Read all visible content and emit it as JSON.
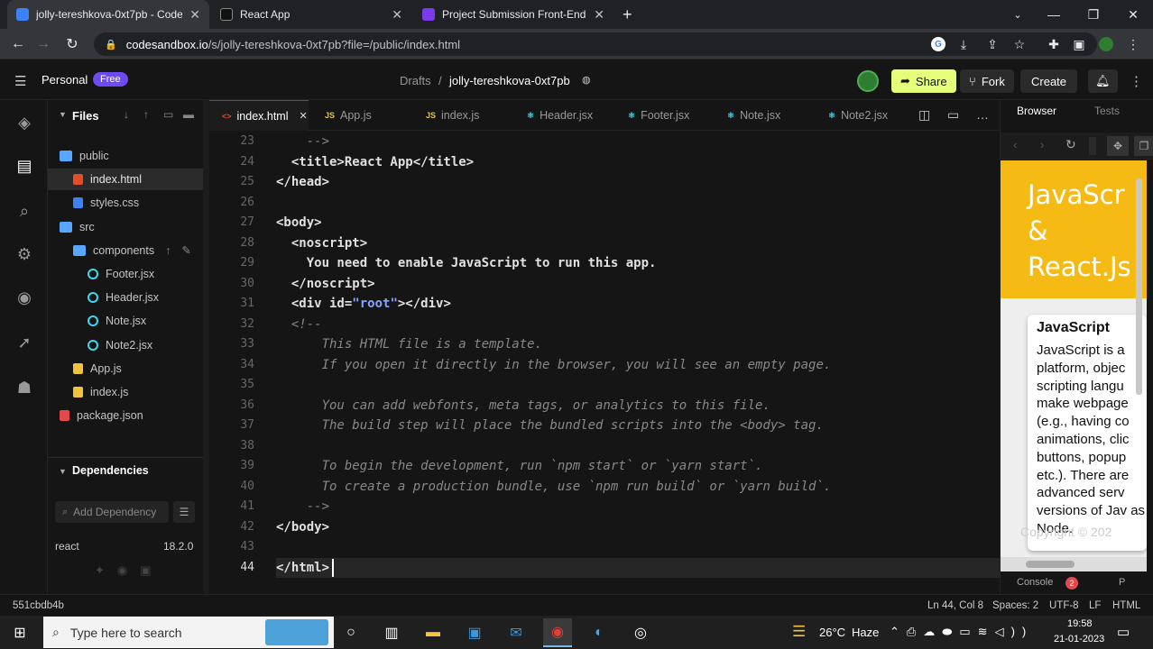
{
  "browser": {
    "tabs": [
      {
        "title": "jolly-tereshkova-0xt7pb - CodeSandbox",
        "color": "#3b82f6"
      },
      {
        "title": "React App",
        "color": "#111111"
      },
      {
        "title": "Project Submission Front-End W...",
        "color": "#7c3aed"
      }
    ],
    "url_host": "codesandbox.io",
    "url_path": "/s/jolly-tereshkova-0xt7pb?file=/public/index.html"
  },
  "header": {
    "workspace": "Personal",
    "plan_badge": "Free",
    "breadcrumb_root": "Drafts",
    "breadcrumb_sep": "/",
    "sandbox_name": "jolly-tereshkova-0xt7pb",
    "share": "Share",
    "fork": "Fork",
    "create": "Create"
  },
  "sidebar": {
    "files_title": "Files",
    "tree": [
      {
        "label": "public",
        "type": "folder",
        "indent": 0
      },
      {
        "label": "index.html",
        "type": "html",
        "indent": 1,
        "selected": true
      },
      {
        "label": "styles.css",
        "type": "css",
        "indent": 1
      },
      {
        "label": "src",
        "type": "folder",
        "indent": 0
      },
      {
        "label": "components",
        "type": "folder",
        "indent": 1
      },
      {
        "label": "Footer.jsx",
        "type": "react",
        "indent": 2
      },
      {
        "label": "Header.jsx",
        "type": "react",
        "indent": 2
      },
      {
        "label": "Note.jsx",
        "type": "react",
        "indent": 2
      },
      {
        "label": "Note2.jsx",
        "type": "react",
        "indent": 2
      },
      {
        "label": "App.js",
        "type": "js",
        "indent": 1
      },
      {
        "label": "index.js",
        "type": "js",
        "indent": 1
      },
      {
        "label": "package.json",
        "type": "json",
        "indent": 0
      }
    ],
    "deps_title": "Dependencies",
    "deps_placeholder": "Add Dependency",
    "deps": [
      {
        "name": "react",
        "version": "18.2.0"
      }
    ]
  },
  "editor": {
    "tabs": [
      "index.html",
      "App.js",
      "index.js",
      "Header.jsx",
      "Footer.jsx",
      "Note.jsx",
      "Note2.jsx"
    ],
    "lines": [
      {
        "n": "23",
        "html": "<span class='cm'>    --></span>"
      },
      {
        "n": "24",
        "html": "  <span class='b'>&lt;title&gt;React App&lt;/title&gt;</span>"
      },
      {
        "n": "25",
        "html": "<span class='b'>&lt;/head&gt;</span>"
      },
      {
        "n": "26",
        "html": ""
      },
      {
        "n": "27",
        "html": "<span class='b'>&lt;body&gt;</span>"
      },
      {
        "n": "28",
        "html": "  <span class='b'>&lt;noscript&gt;</span>"
      },
      {
        "n": "29",
        "html": "    <span class='b'>You need to enable JavaScript to run this app.</span>"
      },
      {
        "n": "30",
        "html": "  <span class='b'>&lt;/noscript&gt;</span>"
      },
      {
        "n": "31",
        "html": "  <span class='b'>&lt;div id=<span class='str'>\"root\"</span>&gt;&lt;/div&gt;</span>"
      },
      {
        "n": "32",
        "html": "<span class='cm'>  &lt;!--</span>"
      },
      {
        "n": "33",
        "html": "<span class='cm'>      This HTML file is a template.</span>"
      },
      {
        "n": "34",
        "html": "<span class='cm'>      If you open it directly in the browser, you will see an empty page.</span>"
      },
      {
        "n": "35",
        "html": ""
      },
      {
        "n": "36",
        "html": "<span class='cm'>      You can add webfonts, meta tags, or analytics to this file.</span>"
      },
      {
        "n": "37",
        "html": "<span class='cm'>      The build step will place the bundled scripts into the &lt;body&gt; tag.</span>"
      },
      {
        "n": "38",
        "html": ""
      },
      {
        "n": "39",
        "html": "<span class='cm'>      To begin the development, run `npm start` or `yarn start`.</span>"
      },
      {
        "n": "40",
        "html": "<span class='cm'>      To create a production bundle, use `npm run build` or `yarn build`.</span>"
      },
      {
        "n": "41",
        "html": "<span class='cm'>    --></span>"
      },
      {
        "n": "42",
        "html": "<span class='b'>&lt;/body&gt;</span>"
      },
      {
        "n": "43",
        "html": ""
      },
      {
        "n": "44",
        "html": "<span class='b'>&lt;/html&gt;</span>"
      }
    ]
  },
  "preview": {
    "tab_browser": "Browser",
    "tab_tests": "Tests",
    "hero_line1": "JavaScr",
    "hero_line2": "&",
    "hero_line3": "React.Js",
    "card_title": "JavaScript",
    "card_body": "JavaScript is a platform, objec scripting langu make webpage (e.g., having co animations, clic buttons, popup etc.). There are advanced serv versions of Jav as Node.",
    "footer": "Copyright © 202",
    "console": "Console",
    "console_count": "2",
    "extra_tab": "P"
  },
  "status": {
    "commit": "551cbdb4b",
    "position": "Ln 44, Col 8",
    "spaces": "Spaces: 2",
    "encoding": "UTF-8",
    "eol": "LF",
    "lang": "HTML"
  },
  "taskbar": {
    "search": "Type here to search",
    "temp": "26°C",
    "weather": "Haze",
    "time": "19:58",
    "date": "21-01-2023"
  }
}
